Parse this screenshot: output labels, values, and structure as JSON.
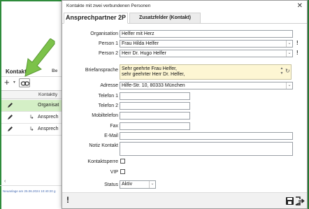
{
  "background": {
    "kontakte_label": "Kontakte",
    "be_label": "Be",
    "grid_header": "Kontaktty",
    "rows": [
      {
        "text": "Organisat"
      },
      {
        "text": "Ansprech"
      },
      {
        "text": "Ansprech"
      }
    ],
    "row_arrow": "↳",
    "plus_icon": "+",
    "status_line": "Neuanlage am 25.06.2024 10:40:20 g"
  },
  "dialog": {
    "title": "Kontakte mit zwei verbundenen Personen",
    "close_icon": "✕",
    "tabs": [
      {
        "label": "Ansprechpartner 2P"
      },
      {
        "label": "Zusatzfelder (Kontakt)"
      }
    ],
    "fields": {
      "organisation": {
        "label": "Organisation",
        "value": "Helfer mit Herz"
      },
      "person1": {
        "label": "Person 1",
        "value": "Frau Hilda Helfer"
      },
      "person2": {
        "label": "Person 2",
        "value": "Herr Dr. Hugo Helfer"
      },
      "briefansprache": {
        "label": "Briefansprache",
        "value_line1": "Sehr geehrte Frau Helfer,",
        "value_line2": "sehr geehrter Herr Dr. Helfer,"
      },
      "adresse": {
        "label": "Adresse",
        "value": "Hilfe-Str. 10, 80333 München"
      },
      "telefon1": {
        "label": "Telefon 1",
        "value": ""
      },
      "telefon2": {
        "label": "Telefon 2",
        "value": ""
      },
      "mobiltelefon": {
        "label": "Mobiltelefon",
        "value": ""
      },
      "fax": {
        "label": "Fax",
        "value": ""
      },
      "email": {
        "label": "E-Mail",
        "value": ""
      },
      "notiz": {
        "label": "Notiz Kontakt",
        "value": ""
      },
      "kontaktsperre": {
        "label": "Kontaktsperre",
        "checked": false
      },
      "vip": {
        "label": "VIP",
        "checked": false
      },
      "status": {
        "label": "Status",
        "value": "Aktiv"
      }
    },
    "excl": "!",
    "footer_excl": "!",
    "dropdown_icon": "⌄"
  },
  "colors": {
    "accent_green": "#2e8b3b",
    "selected_row": "#d4efc6",
    "brief_bg": "#fdf6d3",
    "arrow_green": "#7cc24a"
  }
}
